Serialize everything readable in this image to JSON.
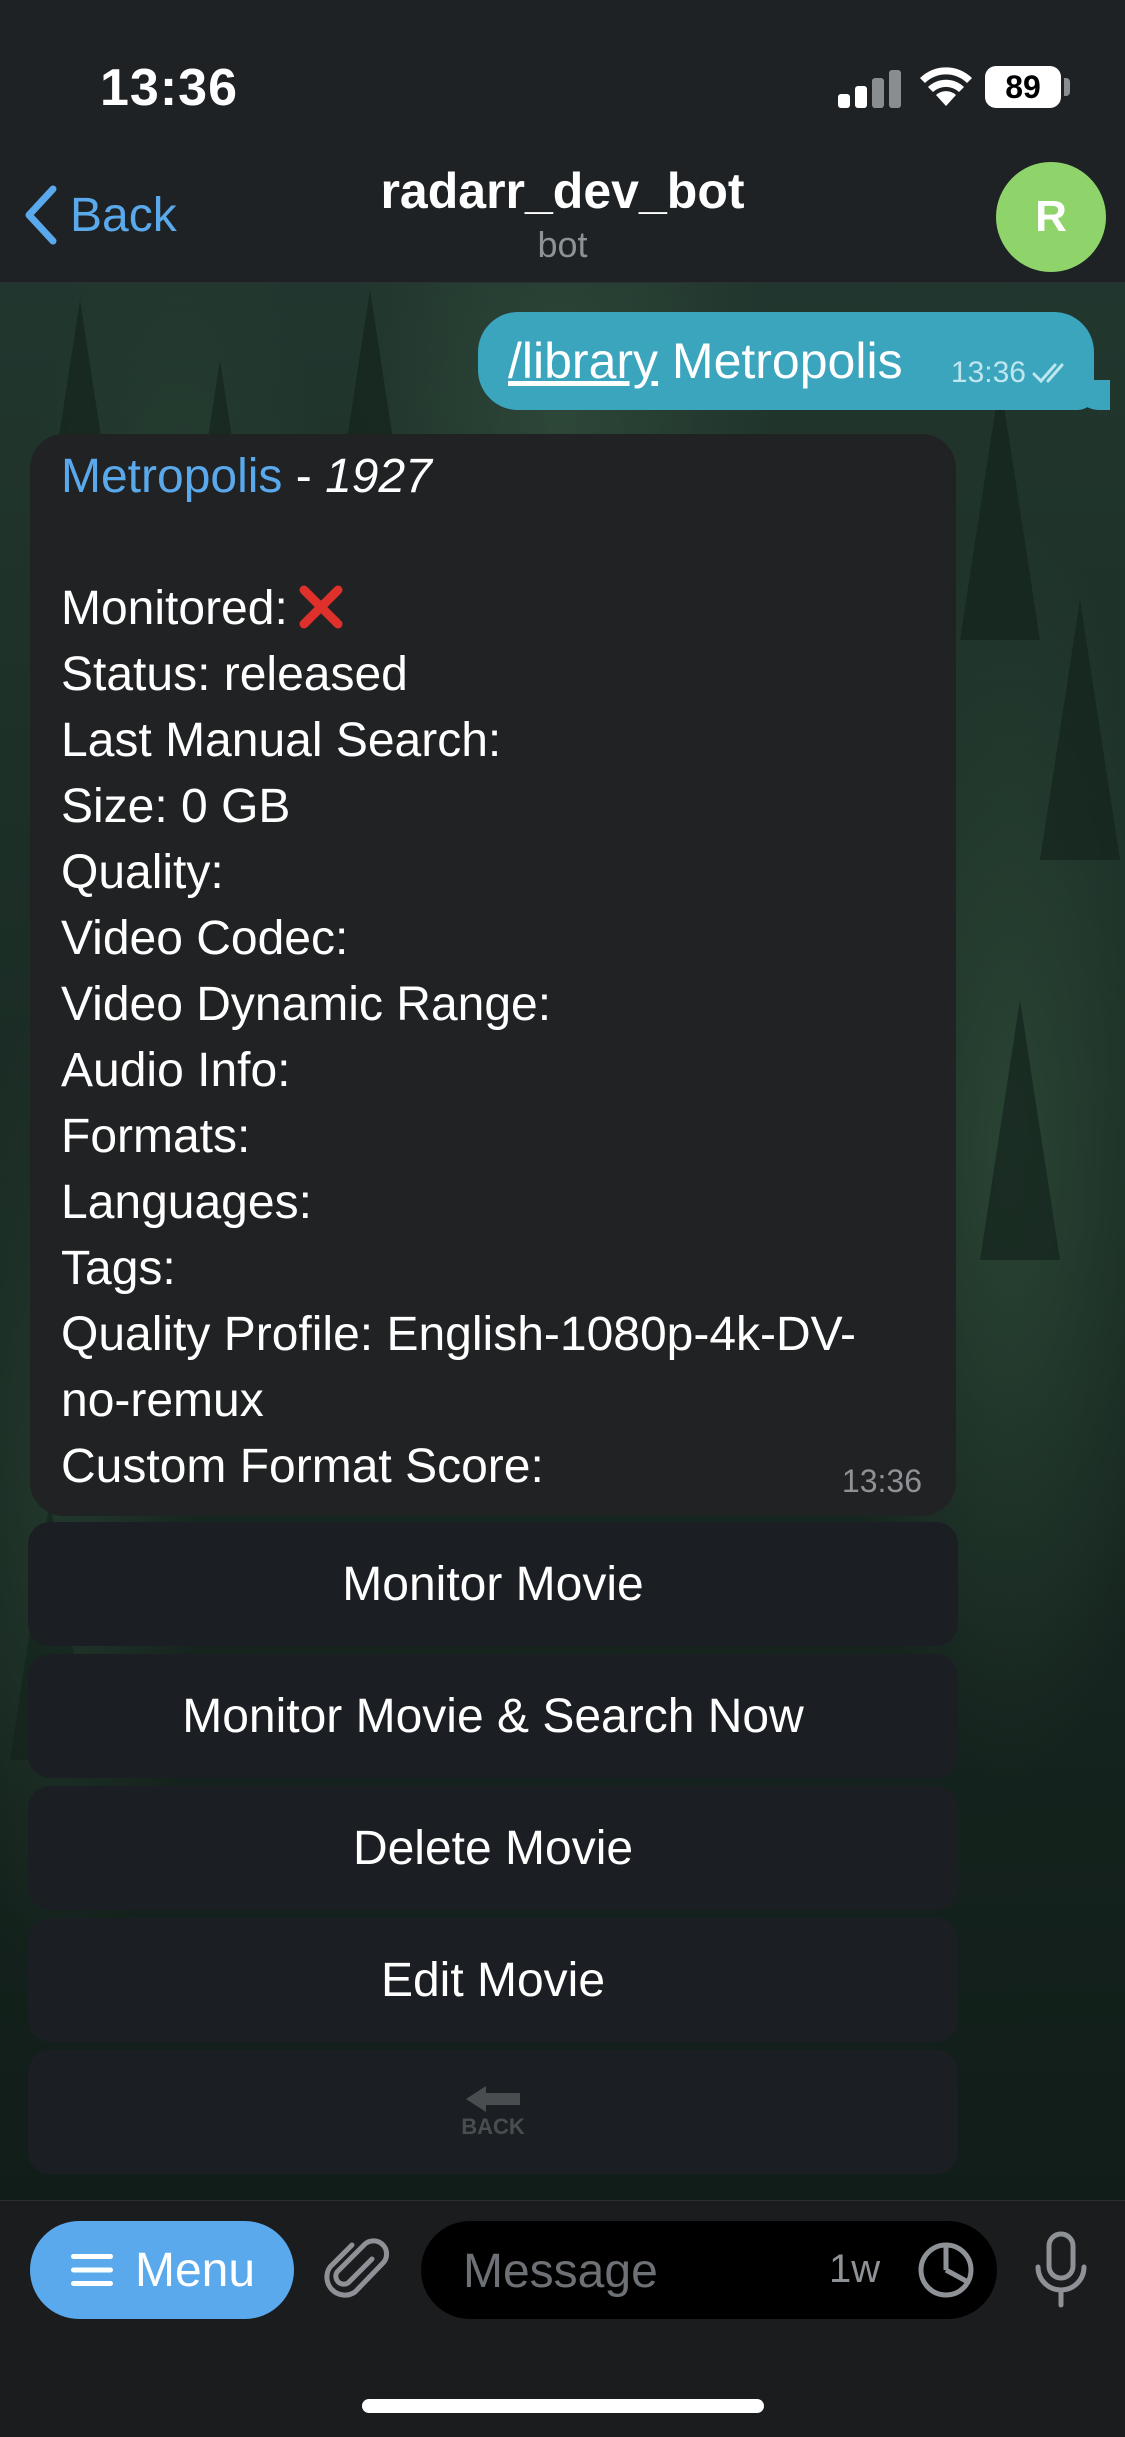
{
  "status_bar": {
    "time": "13:36",
    "battery": "89"
  },
  "header": {
    "back_label": "Back",
    "title": "radarr_dev_bot",
    "subtitle": "bot",
    "avatar_letter": "R"
  },
  "outgoing": {
    "command": "/library",
    "text": " Metropolis",
    "time": "13:36"
  },
  "incoming": {
    "movie_link": "Metropolis",
    "separator": " - ",
    "year": "1927",
    "fields": [
      "Monitored:",
      "Status: released",
      "Last Manual Search:",
      "Size: 0 GB",
      "Quality:",
      "Video Codec:",
      "Video Dynamic Range:",
      "Audio Info:",
      "Formats:",
      "Languages:",
      "Tags:",
      "Quality Profile: English-1080p-4k-DV-",
      "no-remux",
      "Custom Format Score:"
    ],
    "time": "13:36"
  },
  "keyboard": {
    "buttons": [
      "Monitor Movie",
      "Monitor Movie & Search Now",
      "Delete Movie",
      "Edit Movie"
    ],
    "back_icon_text": "BACK"
  },
  "input_bar": {
    "menu_label": "Menu",
    "placeholder": "Message",
    "timer_label": "1w"
  },
  "colors": {
    "accent": "#5aa9ec",
    "outgoing_bubble": "#3ba5be",
    "incoming_bubble": "#212223",
    "avatar": "#8ed46a",
    "cross": "#e0302b"
  }
}
